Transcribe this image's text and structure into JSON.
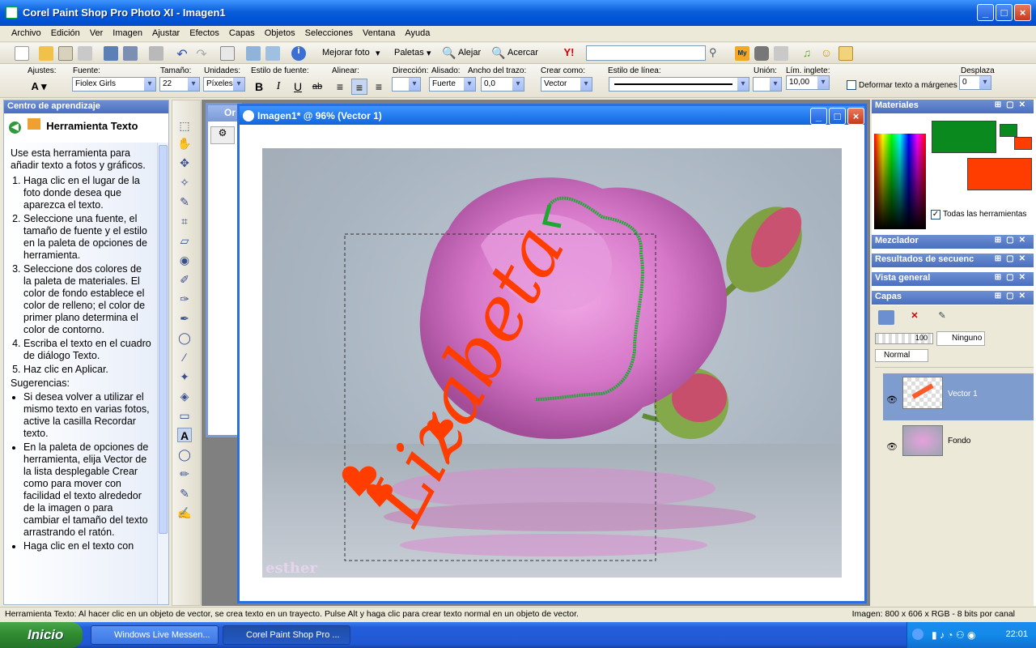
{
  "window": {
    "title": "Corel Paint Shop Pro Photo XI - Imagen1"
  },
  "menu": [
    "Archivo",
    "Edición",
    "Ver",
    "Imagen",
    "Ajustar",
    "Efectos",
    "Capas",
    "Objetos",
    "Selecciones",
    "Ventana",
    "Ayuda"
  ],
  "toolbar": {
    "mejorar_foto": "Mejorar foto",
    "paletas": "Paletas",
    "alejar": "Alejar",
    "acercar": "Acercar",
    "yahoo_search_value": ""
  },
  "options": {
    "ajustes_label": "Ajustes:",
    "fuente_label": "Fuente:",
    "fuente_value": "Fiolex Girls",
    "tamano_label": "Tamaño:",
    "tamano_value": "22",
    "unidades_label": "Unidades:",
    "unidades_value": "Píxeles",
    "estilo_fuente_label": "Estilo de fuente:",
    "alinear_label": "Alinear:",
    "direccion_label": "Dirección:",
    "alisado_label": "Alisado:",
    "alisado_value": "Fuerte",
    "ancho_trazo_label": "Ancho del trazo:",
    "ancho_trazo_value": "0,0",
    "crear_como_label": "Crear como:",
    "crear_como_value": "Vector",
    "estilo_linea_label": "Estilo de línea:",
    "union_label": "Unión:",
    "lim_inglete_label": "Lím. inglete:",
    "lim_inglete_value": "10,00",
    "deformar_label": "Deformar texto a márgenes",
    "desplaza_label": "Desplaza",
    "desplaza_value": "0"
  },
  "learning": {
    "panel_title": "Centro de aprendizaje",
    "tool_title": "Herramienta Texto",
    "intro": "Use esta herramienta para añadir texto a fotos y gráficos.",
    "steps": [
      "Haga clic en el lugar de la foto donde desea que aparezca el texto.",
      "Seleccione una fuente, el tamaño de fuente y el estilo en la paleta de opciones de herramienta.",
      "Seleccione dos colores de la paleta de materiales. El color de fondo establece el color de relleno; el color de primer plano determina el color de contorno.",
      "Escriba el texto en el cuadro de diálogo Texto.",
      "Haz clic en Aplicar."
    ],
    "tips_title": "Sugerencias:",
    "tips": [
      "Si desea volver a utilizar el mismo texto en varias fotos, active la casilla Recordar texto.",
      "En la paleta de opciones de herramienta, elija Vector de la lista desplegable Crear como para mover con facilidad el texto alrededor de la imagen o para cambiar el tamaño del texto arrastrando el ratón.",
      "Haga clic en el texto con"
    ]
  },
  "document": {
    "bg_title": "Or",
    "title": "Imagen1* @  96% (Vector 1)",
    "artwork_text": "Lizabeta",
    "watermark": "esther"
  },
  "panels": {
    "materiales": "Materiales",
    "todas_herramientas": "Todas las herramientas",
    "mezclador": "Mezclador",
    "resultados": "Resultados de secuenc",
    "vista_general": "Vista general",
    "capas": "Capas",
    "opacity": "100",
    "blend_mask": "Ninguno",
    "blend_mode": "Normal",
    "layers": [
      {
        "name": "Vector 1"
      },
      {
        "name": "Fondo"
      }
    ]
  },
  "colors": {
    "foreground": "#0a8a1e",
    "background": "#ff3d00",
    "accent": "#0a5ed9"
  },
  "status": {
    "hint": "Herramienta Texto: Al hacer clic en un objeto de vector, se crea texto en un trayecto. Pulse Alt y haga clic para crear texto normal en un objeto de vector.",
    "image_info": "Imagen:  800 x 606 x RGB - 8 bits por canal"
  },
  "taskbar": {
    "start": "Inicio",
    "tasks": [
      "Windows Live Messen...",
      "Corel Paint Shop Pro ..."
    ],
    "clock": "22:01"
  }
}
